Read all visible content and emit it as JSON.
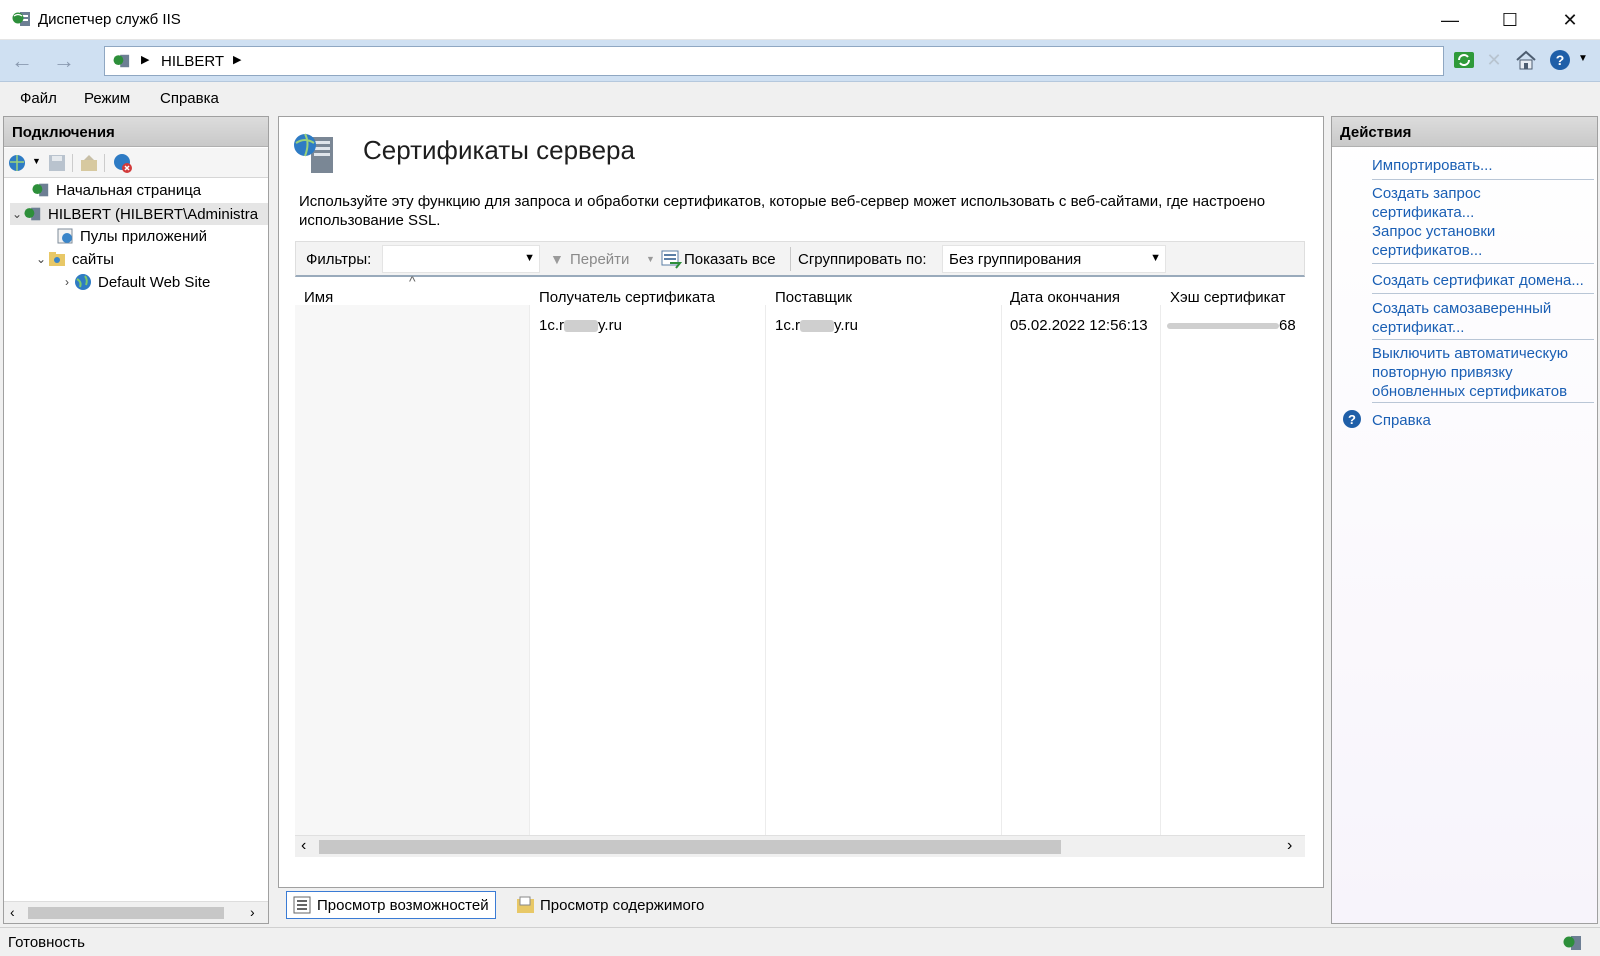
{
  "window": {
    "title": "Диспетчер служб IIS",
    "controls": {
      "minimize": "—",
      "maximize": "☐",
      "close": "✕"
    }
  },
  "address": {
    "crumbs": [
      "HILBERT"
    ]
  },
  "menu": [
    "Файл",
    "Режим",
    "Справка"
  ],
  "connections": {
    "header": "Подключения",
    "tree": [
      {
        "label": "Начальная страница"
      },
      {
        "label": "HILBERT (HILBERT\\Administra"
      },
      {
        "label": "Пулы приложений"
      },
      {
        "label": "сайты"
      },
      {
        "label": "Default Web Site"
      }
    ]
  },
  "feature": {
    "title": "Сертификаты сервера",
    "description": "Используйте эту функцию для запроса и обработки сертификатов, которые веб-сервер может использовать с веб-сайтами, где настроено использование SSL.",
    "filter_label": "Фильтры:",
    "filter_value": "",
    "go_label": "Перейти",
    "show_all_label": "Показать все",
    "group_by_label": "Сгруппировать по:",
    "group_by_value": "Без группирования",
    "columns": [
      "Имя",
      "Получатель сертификата",
      "Поставщик",
      "Дата окончания",
      "Хэш сертификат"
    ],
    "rows": [
      {
        "name": "",
        "subject_pre": "1c.r",
        "subject_post": "y.ru",
        "issuer_pre": "1c.r",
        "issuer_post": "y.ru",
        "expires": "05.02.2022 12:56:13",
        "hash_post": "68"
      }
    ]
  },
  "views": {
    "features": "Просмотр возможностей",
    "content": "Просмотр содержимого"
  },
  "actions": {
    "header": "Действия",
    "items": [
      "Импортировать...",
      "Создать запрос сертификата...",
      "Запрос установки сертификатов...",
      "Создать сертификат домена...",
      "Создать самозаверенный сертификат...",
      "Выключить автоматическую повторную привязку обновленных сертификатов",
      "Справка"
    ]
  },
  "status": {
    "text": "Готовность"
  },
  "colors": {
    "link": "#1a5fb4",
    "addressbar": "#cfe0f2"
  }
}
